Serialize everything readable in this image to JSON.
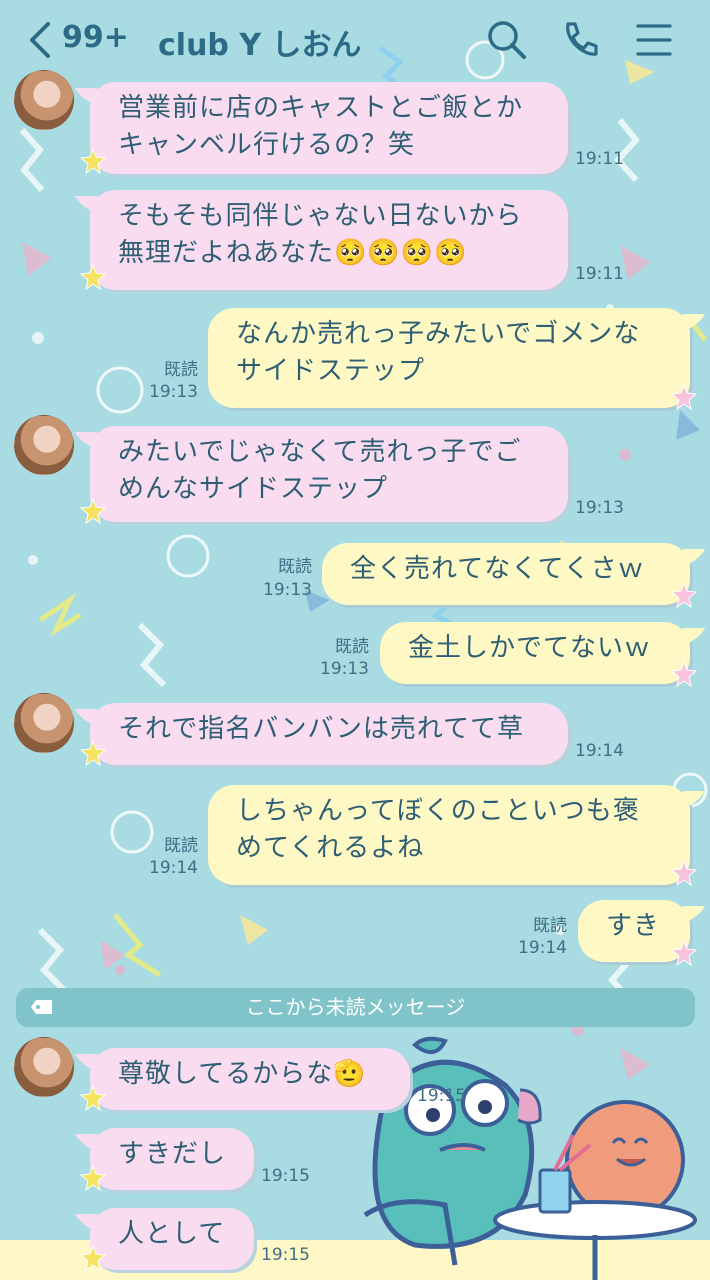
{
  "header": {
    "unread_count": "99+",
    "chat_title": "club Y しおん",
    "icons": [
      "back-chevron-icon",
      "search-icon",
      "phone-icon",
      "menu-icon"
    ]
  },
  "colors": {
    "background": "#a9dbe3",
    "incoming_bubble": "#f9dcf0",
    "outgoing_bubble": "#fdf8c4",
    "text": "#2e5e74",
    "unread_bar": "#80c4ca"
  },
  "messages": [
    {
      "side": "in",
      "text": "営業前に店のキャストとご飯とか\nキャンベル行けるの？笑",
      "time": "19:11"
    },
    {
      "side": "in",
      "text": "そもそも同伴じゃない日ないから\n無理だよねあなた🥺🥺🥺🥺",
      "time": "19:11"
    },
    {
      "side": "out",
      "text": "なんか売れっ子みたいでゴメンな\nサイドステップ",
      "read": "既読",
      "time": "19:13"
    },
    {
      "side": "in",
      "text": "みたいでじゃなくて売れっ子でご\nめんなサイドステップ",
      "time": "19:13"
    },
    {
      "side": "out",
      "text": "全く売れてなくてくさｗ",
      "read": "既読",
      "time": "19:13"
    },
    {
      "side": "out",
      "text": "金土しかでてないｗ",
      "read": "既読",
      "time": "19:13"
    },
    {
      "side": "in",
      "text": "それで指名バンバンは売れてて草",
      "time": "19:14"
    },
    {
      "side": "out",
      "text": "しちゃんってぼくのこといつも褒\nめてくれるよね",
      "read": "既読",
      "time": "19:14"
    },
    {
      "side": "out",
      "text": "すき",
      "read": "既読",
      "time": "19:14"
    },
    {
      "side": "in",
      "text": "尊敬してるからな🫡",
      "time": "19:15"
    },
    {
      "side": "in",
      "text": "すきだし",
      "time": "19:15"
    },
    {
      "side": "in",
      "text": "人として",
      "time": "19:15"
    }
  ],
  "unread_divider": "ここから未読メッセージ"
}
